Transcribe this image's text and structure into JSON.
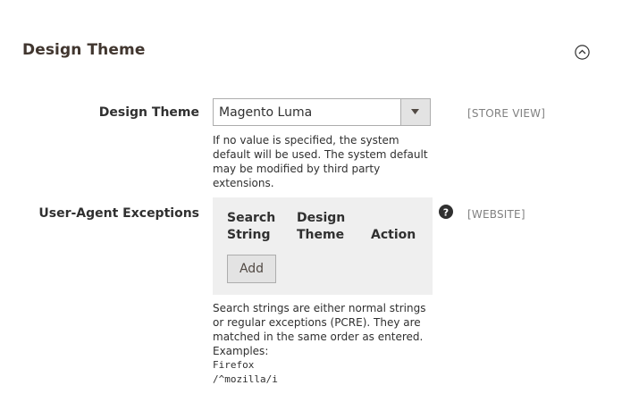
{
  "section": {
    "title": "Design Theme",
    "collapse_icon": "chevron-up-circle-icon"
  },
  "design_theme": {
    "label": "Design Theme",
    "selected_value": "Magento Luma",
    "scope": "[STORE VIEW]",
    "note": "If no value is specified, the system default will be used. The system default may be modified by third party extensions."
  },
  "user_agent": {
    "label": "User-Agent Exceptions",
    "scope": "[WEBSITE]",
    "help_icon": "question-circle-icon",
    "columns": {
      "search_line1": "Search",
      "search_line2": "String",
      "design_line1": "Design",
      "design_line2": "Theme",
      "action": "Action"
    },
    "add_label": "Add",
    "note": "Search strings are either normal strings or regular exceptions (PCRE). They are matched in the same order as entered.",
    "examples_label": "Examples:",
    "example1": "Firefox",
    "example2": "/^mozilla/i"
  }
}
